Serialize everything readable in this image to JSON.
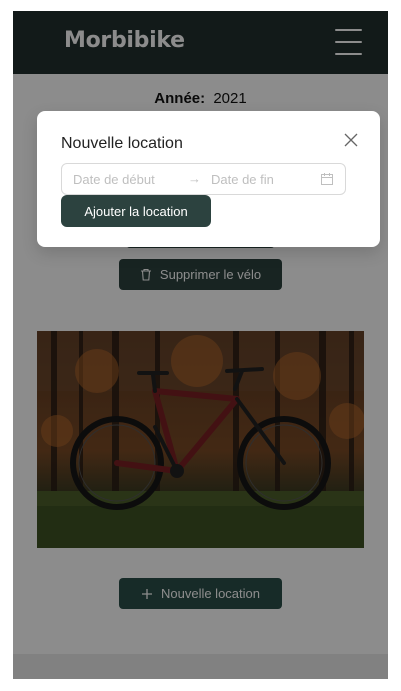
{
  "navbar": {
    "brand": "Morbibike",
    "menu_icon": "hamburger-menu-icon"
  },
  "main": {
    "year_label": "Année:",
    "year_value": "2021",
    "delete_button": {
      "label": "Supprimer le vélo",
      "icon": "trash-icon"
    },
    "photo_alt": "Vélo tout-terrain rouge dans une forêt",
    "new_rental_button": {
      "label": "Nouvelle location",
      "icon": "plus-icon"
    }
  },
  "modal": {
    "title": "Nouvelle location",
    "close_icon": "close-icon",
    "start_placeholder": "Date de début",
    "end_placeholder": "Date de fin",
    "arrow_icon": "arrow-right-icon",
    "calendar_icon": "calendar-icon",
    "submit_label": "Ajouter la location"
  },
  "colors": {
    "navbar": "#22302e",
    "button_dark": "#2c423f",
    "button_teal": "#2b4f4a",
    "overlay": "rgba(0,0,0,0.45)"
  }
}
